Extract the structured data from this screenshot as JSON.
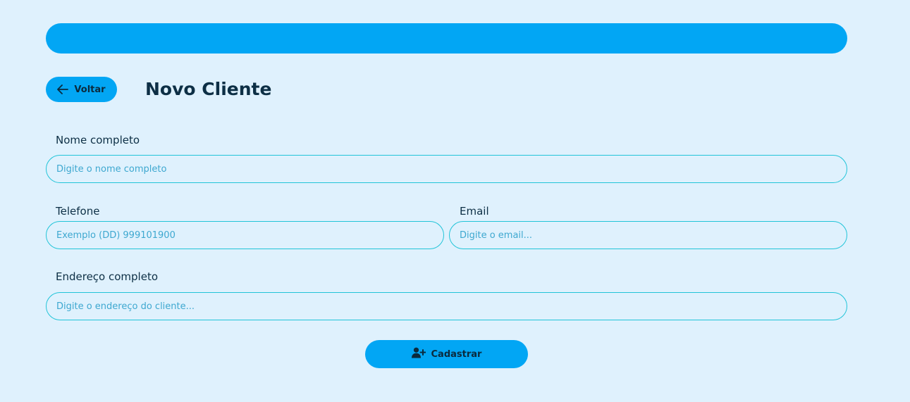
{
  "header": {
    "title": "Novo Cliente",
    "back_label": "Voltar"
  },
  "form": {
    "name": {
      "label": "Nome completo",
      "placeholder": "Digite o nome completo",
      "value": ""
    },
    "phone": {
      "label": "Telefone",
      "placeholder": "Exemplo (DD) 999101900",
      "value": ""
    },
    "email": {
      "label": "Email",
      "placeholder": "Digite o email...",
      "value": ""
    },
    "address": {
      "label": "Endereço completo",
      "placeholder": "Digite o endereço do cliente...",
      "value": ""
    },
    "submit_label": "Cadastrar"
  },
  "icons": {
    "back": "arrow-left-icon",
    "submit": "user-plus-icon"
  },
  "colors": {
    "background": "#dff1fd",
    "accent": "#02a6f4",
    "input_border": "#21c4d8",
    "text_dark": "#0d2f45",
    "placeholder": "#3ea8d0"
  }
}
